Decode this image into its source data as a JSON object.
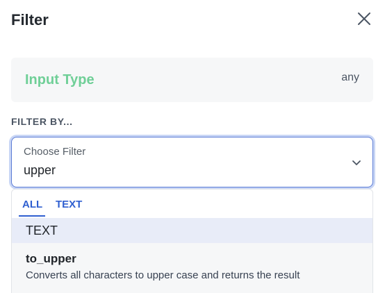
{
  "header": {
    "title": "Filter",
    "close_icon": "close-icon"
  },
  "input_type": {
    "label": "Input Type",
    "value": "any"
  },
  "filter_by": {
    "label": "FILTER BY..."
  },
  "select": {
    "placeholder": "Choose Filter",
    "value": "upper",
    "chevron_icon": "chevron-down-icon"
  },
  "dropdown": {
    "tabs": [
      {
        "label": "ALL",
        "active": true
      },
      {
        "label": "TEXT",
        "active": false
      }
    ],
    "group": {
      "label": "TEXT"
    },
    "options": [
      {
        "name": "to_upper",
        "description": "Converts all characters to upper case and returns the result"
      }
    ]
  },
  "colors": {
    "accent": "#2f5fd0",
    "input_type_label": "#6fcf97",
    "group_header_bg": "#e8ecf8"
  }
}
